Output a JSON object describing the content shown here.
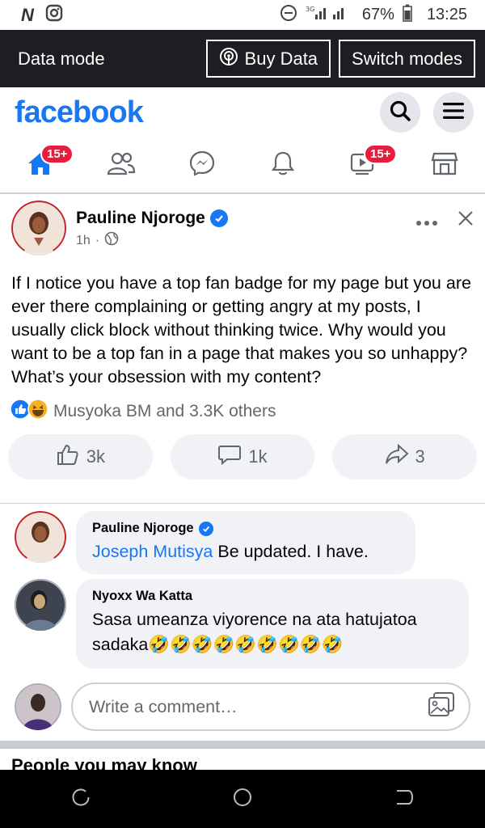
{
  "status": {
    "battery": "67%",
    "time": "13:25"
  },
  "data_bar": {
    "label": "Data mode",
    "buy_label": "Buy Data",
    "switch_label": "Switch modes"
  },
  "header": {
    "logo": "facebook"
  },
  "nav": {
    "home_badge": "15+",
    "watch_badge": "15+"
  },
  "post": {
    "author": "Pauline Njoroge",
    "time": "1h",
    "separator": "·",
    "text": "If I notice you have a top fan badge for my page but you are ever there complaining or getting angry at my posts, I usually click block without thinking twice. Why would you want to be a top fan in a page that makes you so unhappy? What’s your obsession with my content?",
    "reactions": "Musyoka BM and 3.3K others",
    "like_count": "3k",
    "comment_count": "1k",
    "share_count": "3"
  },
  "comments": [
    {
      "author": "Pauline Njoroge",
      "mention": "Joseph Mutisya",
      "text": " Be updated. I have."
    },
    {
      "author": "Nyoxx Wa Katta",
      "text": "Sasa umeanza viyorence na ata hatujatoa sadaka🤣🤣🤣🤣🤣🤣🤣🤣🤣"
    }
  ],
  "composer": {
    "placeholder": "Write a comment…"
  },
  "suggestions": {
    "title": "People you may know"
  },
  "colors": {
    "brand": "#1877f2",
    "badge": "#e41e3f",
    "bubble": "#f0f2f5"
  }
}
